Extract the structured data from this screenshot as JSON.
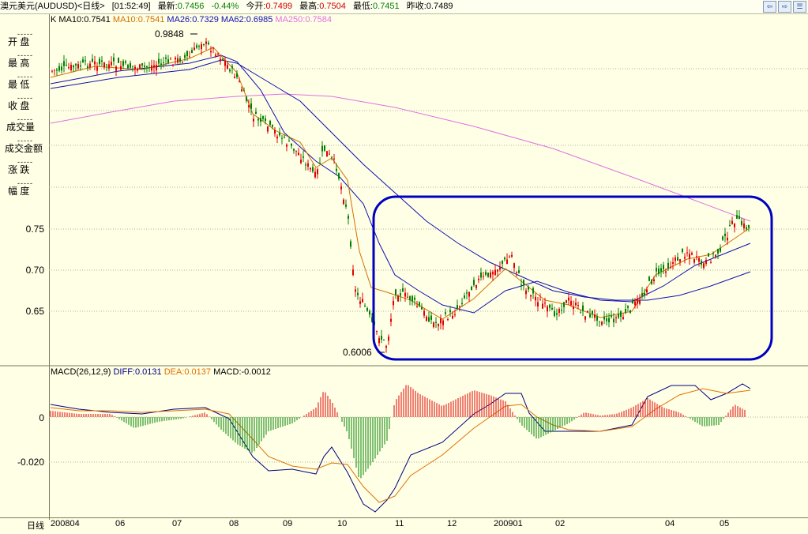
{
  "header": {
    "title": "澳元美元(AUDUSD)<日线>",
    "time": "[01:52:49]",
    "latest_label": "最新:",
    "latest": "0.7456",
    "change": "-0.44%",
    "open_label": "今开:",
    "open": "0.7499",
    "high_label": "最高:",
    "high": "0.7504",
    "low_label": "最低:",
    "low": "0.7451",
    "prev_close_label": "昨收:",
    "prev_close": "0.7489"
  },
  "nav": {
    "left": "⇦",
    "right": "⇨",
    "menu": "☰"
  },
  "indicators": {
    "k": "K",
    "ma10_a": "MA10:0.7541",
    "ma10_b": "MA10:0.7541",
    "ma26": "MA26:0.7329",
    "ma62": "MA62:0.6985",
    "ma250": "MA250:0.7584",
    "colors": {
      "ma10": "#d07000",
      "ma26": "#1010b0",
      "ma62": "#1010b0",
      "ma250": "#e070e0",
      "up": "#e00000",
      "down": "#008000",
      "highlight": "#0000c0"
    }
  },
  "left_panel": {
    "rows": [
      {
        "label": "开  盘"
      },
      {
        "label": "最  高"
      },
      {
        "label": "最  低"
      },
      {
        "label": "收  盘"
      },
      {
        "label": "成交量"
      },
      {
        "label": "成交金额"
      },
      {
        "label": "涨  跌"
      },
      {
        "label": "幅  度"
      }
    ],
    "dashes": "-----"
  },
  "price_axis": [
    "0.75",
    "0.70",
    "0.65"
  ],
  "annotations": {
    "high_marker": "0.9848",
    "low_marker": "0.6006"
  },
  "macd": {
    "name": "MACD(26,12,9)",
    "diff": "DIFF:0.0131",
    "dea": "DEA:0.0137",
    "macd": "MACD:-0.0012",
    "axis": [
      "0",
      "-0.020"
    ]
  },
  "date_axis": {
    "label": "日线",
    "ticks": [
      "200804",
      "06",
      "07",
      "08",
      "09",
      "10",
      "11",
      "12",
      "200901",
      "02",
      "04",
      "05"
    ]
  }
}
